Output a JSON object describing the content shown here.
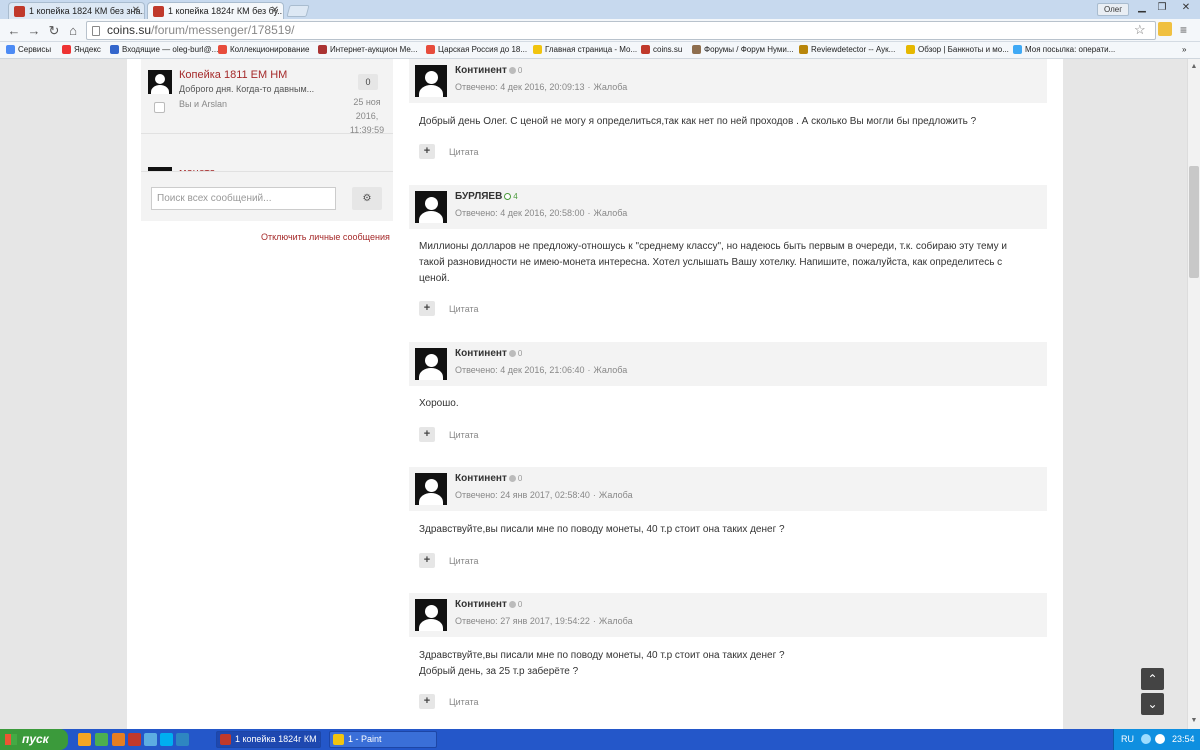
{
  "browser": {
    "tabs": [
      {
        "title": "1 копейка 1824 КМ без зна..."
      },
      {
        "title": "1 копейка 1824г КМ без бу..."
      }
    ],
    "user": "Олег",
    "address": {
      "host": "coins.su",
      "path": "/forum/messenger/178519/"
    },
    "bookmarks": [
      {
        "label": "Сервисы",
        "color": "#4c8bf5"
      },
      {
        "label": "Яндекс",
        "color": "#e33"
      },
      {
        "label": "Входящие — oleg-burl@...",
        "color": "#3366cc"
      },
      {
        "label": "Коллекционирование",
        "color": "#e74c3c"
      },
      {
        "label": "Интернет-аукцион Ме...",
        "color": "#a33"
      },
      {
        "label": "Царская Россия до 18...",
        "color": "#e74c3c"
      },
      {
        "label": "Главная страница - Мо...",
        "color": "#f1c40f"
      },
      {
        "label": "coins.su",
        "color": "#c0392b"
      },
      {
        "label": "Форумы / Форум Нуми...",
        "color": "#8e6e4e"
      },
      {
        "label": "Reviewdetector -- Аук...",
        "color": "#b8860b"
      },
      {
        "label": "Обзор | Банкноты и мо...",
        "color": "#e6b800"
      },
      {
        "label": "Моя посылка: операти...",
        "color": "#3fa9f5"
      }
    ]
  },
  "sidebar": {
    "conversation": {
      "title": "Копейка 1811 ЕМ НМ",
      "snippet": "Доброго дня. Когда-то давным...",
      "participants": "Вы и Arslan",
      "count": "0",
      "date_line1": "25 ноя",
      "date_line2": "2016,",
      "date_line3": "11:39:59"
    },
    "next_conversation_title": "монета",
    "search_placeholder": "Поиск всех сообщений...",
    "settings_icon": "gear-icon",
    "disable_link": "Отключить личные сообщения"
  },
  "posts": [
    {
      "author": "Континент",
      "rep": "0",
      "rep_positive": false,
      "prefix": "Отвечено:",
      "date": "4 дек 2016, 20:09:13",
      "report": "Жалоба",
      "lines": [
        "Добрый день Олег. С ценой не могу я определиться,так как нет по ней проходов . А сколько Вы могли бы предложить ?"
      ],
      "quote": "Цитата"
    },
    {
      "author": "БУРЛЯЕВ",
      "rep": "4",
      "rep_positive": true,
      "prefix": "Отвечено:",
      "date": "4 дек 2016, 20:58:00",
      "report": "Жалоба",
      "lines": [
        "Миллионы долларов не предложу-отношусь к \"среднему классу\", но надеюсь быть первым в очереди, т.к. собираю эту тему и",
        "такой разновидности не имею-монета интересна. Хотел услышать Вашу хотелку. Напишите, пожалуйста, как определитесь с",
        "ценой."
      ],
      "quote": "Цитата"
    },
    {
      "author": "Континент",
      "rep": "0",
      "rep_positive": false,
      "prefix": "Отвечено:",
      "date": "4 дек 2016, 21:06:40",
      "report": "Жалоба",
      "lines": [
        "Хорошо."
      ],
      "quote": "Цитата"
    },
    {
      "author": "Континент",
      "rep": "0",
      "rep_positive": false,
      "prefix": "Отвечено:",
      "date": "24 янв 2017, 02:58:40",
      "report": "Жалоба",
      "lines": [
        "Здравствуйте,вы писали мне по поводу монеты, 40 т.р стоит она таких денег ?"
      ],
      "quote": "Цитата"
    },
    {
      "author": "Континент",
      "rep": "0",
      "rep_positive": false,
      "prefix": "Отвечено:",
      "date": "27 янв 2017, 19:54:22",
      "report": "Жалоба",
      "lines": [
        "Здравствуйте,вы писали мне по поводу монеты, 40 т.р стоит она таких денег ?",
        "Добрый день, за 25 т.р заберёте ?"
      ],
      "quote": "Цитата"
    }
  ],
  "taskbar": {
    "start_label": "пуск",
    "tasks": [
      {
        "label": "1 копейка 1824г КМ ...",
        "color": "#c0392b"
      },
      {
        "label": "1 - Paint",
        "color": "#f1c40f"
      }
    ],
    "lang": "RU",
    "clock": "23:54"
  }
}
